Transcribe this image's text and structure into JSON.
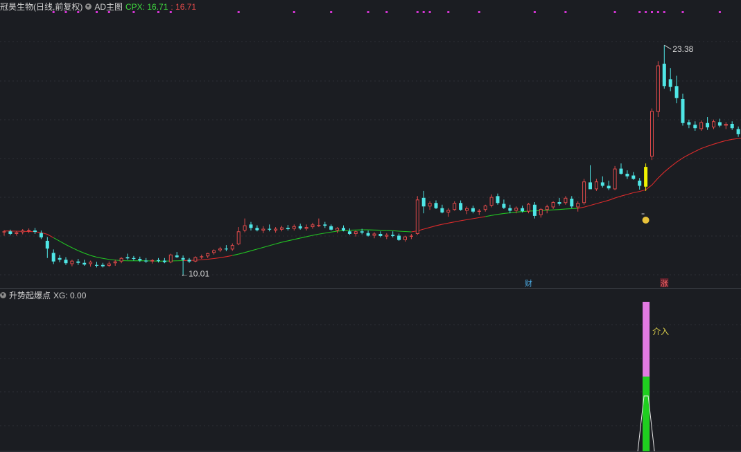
{
  "header": {
    "stock_title": "冠昊生物(日线,前复权)",
    "main_indicator": "AD主图",
    "cpx_label": "CPX: 16.71",
    "cpx_value2": ": 16.71",
    "sub_indicator": "升势起爆点",
    "xg_label": "XG: 0.00"
  },
  "annotations": {
    "high_label": "23.38",
    "low_label": "←10.01",
    "event_cai": "财",
    "event_zhang": "涨",
    "entry_label": "介入"
  },
  "colors": {
    "background": "#1b1d22",
    "up": "#e04a4a",
    "down": "#4fe6e6",
    "highlight_bar": "#f2f200",
    "ma_up": "#dd2b2b",
    "ma_down": "#22c422",
    "signal_pink": "#e27ae2",
    "signal_green": "#1fcf1f",
    "dot_magenta": "#d235d2",
    "label_yellow": "#d8cc4a"
  },
  "chart_data": [
    {
      "type": "candlestick",
      "title": "冠昊生物(日线,前复权)",
      "ylim": [
        9.3,
        25.2
      ],
      "high": 23.38,
      "low": 10.01,
      "last_close": 16.71,
      "series": [
        {
          "name": "candles",
          "columns": [
            "open",
            "high",
            "low",
            "close"
          ],
          "values": [
            [
              12.5,
              12.62,
              12.3,
              12.55
            ],
            [
              12.55,
              12.65,
              12.32,
              12.4
            ],
            [
              12.4,
              12.58,
              12.3,
              12.5
            ],
            [
              12.5,
              12.68,
              12.38,
              12.6
            ],
            [
              12.55,
              12.72,
              12.45,
              12.62
            ],
            [
              12.6,
              12.75,
              12.4,
              12.52
            ],
            [
              12.45,
              12.6,
              12.1,
              12.2
            ],
            [
              12.0,
              12.22,
              11.0,
              11.55
            ],
            [
              11.3,
              11.5,
              10.65,
              10.8
            ],
            [
              11.0,
              11.18,
              10.75,
              10.9
            ],
            [
              10.9,
              11.05,
              10.6,
              10.7
            ],
            [
              10.65,
              10.9,
              10.52,
              10.84
            ],
            [
              10.8,
              10.95,
              10.6,
              10.72
            ],
            [
              10.72,
              10.9,
              10.55,
              10.62
            ],
            [
              10.65,
              10.85,
              10.5,
              10.78
            ],
            [
              10.6,
              10.78,
              10.45,
              10.55
            ],
            [
              10.6,
              10.72,
              10.45,
              10.52
            ],
            [
              10.55,
              10.8,
              10.48,
              10.68
            ],
            [
              10.7,
              10.9,
              10.55,
              10.8
            ],
            [
              10.8,
              11.05,
              10.7,
              11.0
            ],
            [
              11.05,
              11.25,
              10.9,
              10.98
            ],
            [
              11.0,
              11.12,
              10.85,
              10.95
            ],
            [
              10.95,
              11.08,
              10.78,
              10.86
            ],
            [
              10.85,
              11.0,
              10.72,
              10.8
            ],
            [
              10.8,
              10.94,
              10.68,
              10.88
            ],
            [
              10.88,
              11.0,
              10.74,
              10.82
            ],
            [
              10.85,
              11.0,
              10.7,
              10.76
            ],
            [
              10.75,
              11.25,
              10.7,
              11.2
            ],
            [
              11.15,
              11.35,
              11.0,
              11.05
            ],
            [
              11.0,
              11.15,
              10.01,
              10.9
            ],
            [
              10.9,
              11.0,
              10.72,
              10.8
            ],
            [
              10.8,
              11.1,
              10.75,
              11.05
            ],
            [
              11.05,
              11.2,
              10.95,
              11.1
            ],
            [
              11.1,
              11.3,
              11.0,
              11.28
            ],
            [
              11.3,
              11.5,
              11.2,
              11.45
            ],
            [
              11.45,
              11.65,
              11.35,
              11.55
            ],
            [
              11.55,
              11.75,
              11.4,
              11.5
            ],
            [
              11.5,
              11.85,
              11.42,
              11.75
            ],
            [
              11.8,
              12.8,
              11.75,
              12.55
            ],
            [
              12.6,
              13.3,
              12.5,
              12.9
            ],
            [
              12.95,
              13.1,
              12.6,
              12.75
            ],
            [
              12.75,
              12.9,
              12.55,
              12.62
            ],
            [
              12.6,
              12.85,
              12.45,
              12.7
            ],
            [
              12.7,
              12.95,
              12.55,
              12.65
            ],
            [
              12.6,
              12.8,
              12.48,
              12.7
            ],
            [
              12.65,
              12.88,
              12.55,
              12.78
            ],
            [
              12.75,
              12.92,
              12.6,
              12.68
            ],
            [
              12.7,
              12.95,
              12.6,
              12.85
            ],
            [
              12.85,
              13.0,
              12.65,
              12.72
            ],
            [
              12.7,
              12.95,
              12.6,
              12.8
            ],
            [
              12.8,
              13.05,
              12.7,
              12.95
            ],
            [
              12.9,
              13.3,
              12.8,
              12.92
            ],
            [
              12.95,
              13.1,
              12.75,
              12.88
            ],
            [
              12.85,
              12.95,
              12.6,
              12.65
            ],
            [
              12.6,
              12.8,
              12.45,
              12.75
            ],
            [
              12.75,
              12.9,
              12.55,
              12.6
            ],
            [
              12.55,
              12.72,
              12.35,
              12.4
            ],
            [
              12.4,
              12.6,
              12.25,
              12.55
            ],
            [
              12.55,
              12.7,
              12.38,
              12.48
            ],
            [
              12.45,
              12.6,
              12.25,
              12.3
            ],
            [
              12.3,
              12.5,
              12.15,
              12.42
            ],
            [
              12.4,
              12.55,
              12.2,
              12.28
            ],
            [
              12.25,
              12.45,
              12.1,
              12.35
            ],
            [
              12.35,
              12.55,
              12.2,
              12.28
            ],
            [
              12.3,
              12.42,
              12.0,
              12.05
            ],
            [
              12.05,
              12.3,
              11.95,
              12.25
            ],
            [
              12.25,
              12.4,
              12.1,
              12.3
            ],
            [
              12.4,
              14.6,
              12.35,
              14.4
            ],
            [
              14.5,
              14.9,
              13.6,
              14.0
            ],
            [
              14.0,
              14.3,
              13.8,
              14.2
            ],
            [
              14.2,
              14.35,
              13.85,
              13.9
            ],
            [
              13.9,
              14.1,
              13.6,
              13.65
            ],
            [
              13.65,
              13.9,
              13.4,
              13.8
            ],
            [
              13.8,
              14.3,
              13.75,
              14.2
            ],
            [
              14.2,
              14.35,
              13.75,
              13.8
            ],
            [
              13.75,
              14.0,
              13.55,
              13.9
            ],
            [
              13.9,
              14.05,
              13.6,
              13.7
            ],
            [
              13.7,
              13.85,
              13.5,
              13.75
            ],
            [
              13.8,
              14.1,
              13.7,
              14.05
            ],
            [
              14.05,
              14.7,
              13.95,
              14.55
            ],
            [
              14.6,
              14.75,
              14.1,
              14.2
            ],
            [
              14.15,
              14.4,
              13.85,
              13.92
            ],
            [
              13.9,
              14.1,
              13.6,
              13.75
            ],
            [
              13.75,
              14.0,
              13.6,
              13.92
            ],
            [
              13.9,
              14.05,
              13.65,
              13.72
            ],
            [
              13.7,
              14.2,
              13.6,
              14.15
            ],
            [
              14.1,
              14.25,
              13.3,
              13.45
            ],
            [
              13.5,
              13.9,
              13.35,
              13.85
            ],
            [
              13.8,
              14.1,
              13.6,
              14.0
            ],
            [
              13.95,
              14.3,
              13.85,
              14.25
            ],
            [
              14.25,
              14.5,
              14.05,
              14.15
            ],
            [
              14.2,
              14.6,
              14.1,
              14.5
            ],
            [
              14.45,
              14.6,
              13.9,
              14.0
            ],
            [
              13.95,
              14.3,
              13.7,
              14.2
            ],
            [
              14.2,
              15.6,
              14.1,
              15.45
            ],
            [
              15.4,
              16.4,
              15.2,
              15.0
            ],
            [
              15.0,
              15.6,
              14.9,
              15.45
            ],
            [
              15.4,
              15.75,
              15.1,
              15.2
            ],
            [
              15.2,
              15.5,
              14.95,
              15.05
            ],
            [
              15.0,
              16.35,
              14.95,
              16.2
            ],
            [
              16.2,
              16.5,
              15.85,
              15.9
            ],
            [
              15.9,
              16.1,
              15.6,
              15.75
            ],
            [
              15.8,
              16.0,
              15.55,
              15.6
            ],
            [
              15.5,
              15.65,
              14.98,
              15.2
            ],
            [
              15.15,
              16.5,
              14.9,
              16.3
            ],
            [
              16.9,
              19.7,
              16.7,
              19.55
            ],
            [
              19.5,
              22.45,
              19.2,
              22.2
            ],
            [
              22.3,
              23.38,
              20.85,
              21.0
            ],
            [
              21.4,
              22.05,
              20.7,
              20.95
            ],
            [
              21.0,
              21.6,
              20.0,
              20.3
            ],
            [
              20.25,
              20.55,
              18.7,
              18.85
            ],
            [
              18.9,
              19.05,
              18.55,
              18.75
            ],
            [
              18.75,
              18.95,
              18.4,
              18.55
            ],
            [
              18.5,
              19.0,
              18.4,
              18.9
            ],
            [
              18.85,
              19.2,
              18.45,
              18.6
            ],
            [
              18.6,
              19.05,
              18.5,
              18.95
            ],
            [
              18.9,
              19.1,
              18.6,
              18.7
            ],
            [
              18.7,
              18.9,
              18.5,
              18.8
            ],
            [
              18.8,
              18.95,
              18.45,
              18.55
            ],
            [
              18.5,
              18.65,
              18.05,
              18.2
            ],
            [
              18.2,
              18.5,
              18.05,
              18.4
            ]
          ]
        },
        {
          "name": "ma",
          "values": [
            12.58,
            12.57,
            12.56,
            12.55,
            12.54,
            12.53,
            12.48,
            12.38,
            12.18,
            11.98,
            11.78,
            11.6,
            11.43,
            11.28,
            11.15,
            11.05,
            10.98,
            10.92,
            10.88,
            10.85,
            10.84,
            10.84,
            10.84,
            10.84,
            10.83,
            10.82,
            10.82,
            10.83,
            10.84,
            10.85,
            10.86,
            10.87,
            10.9,
            10.93,
            10.97,
            11.02,
            11.08,
            11.15,
            11.23,
            11.32,
            11.42,
            11.52,
            11.62,
            11.72,
            11.82,
            11.92,
            12.0,
            12.08,
            12.16,
            12.24,
            12.32,
            12.39,
            12.45,
            12.51,
            12.56,
            12.6,
            12.62,
            12.63,
            12.64,
            12.64,
            12.63,
            12.62,
            12.61,
            12.59,
            12.56,
            12.54,
            12.52,
            12.58,
            12.68,
            12.78,
            12.88,
            12.96,
            13.03,
            13.1,
            13.17,
            13.23,
            13.29,
            13.35,
            13.41,
            13.48,
            13.54,
            13.59,
            13.63,
            13.67,
            13.7,
            13.73,
            13.74,
            13.76,
            13.78,
            13.8,
            13.82,
            13.85,
            13.87,
            13.89,
            13.96,
            14.06,
            14.16,
            14.26,
            14.36,
            14.49,
            14.6,
            14.7,
            14.8,
            14.87,
            14.97,
            15.25,
            15.65,
            16.0,
            16.3,
            16.58,
            16.82,
            17.02,
            17.2,
            17.37,
            17.5,
            17.62,
            17.73,
            17.83,
            17.9,
            17.95,
            18.0
          ]
        }
      ],
      "ma_colored_green_ranges": [
        [
          8,
          29
        ],
        [
          37,
          66
        ],
        [
          78,
          93
        ]
      ],
      "highlight_index": 104,
      "low_index": 29,
      "high_index": 107,
      "event_markers": [
        {
          "index": 85,
          "label": "财"
        },
        {
          "index": 107,
          "label": "涨"
        }
      ],
      "signal_dots_indices": [
        8,
        10,
        12,
        15,
        17,
        21,
        25,
        27,
        38,
        47,
        53,
        59,
        62,
        67,
        72,
        77,
        86,
        91,
        99,
        107,
        110,
        116,
        121
      ],
      "signal_dots_cluster": [
        [
          103,
          104,
          105,
          106,
          107
        ],
        [
          67,
          68,
          69
        ]
      ]
    },
    {
      "type": "bar",
      "title": "升势起爆点",
      "ylim": [
        0,
        1
      ],
      "series": [
        {
          "name": "XG",
          "signal_index": 104,
          "value": 0.0,
          "pink_fraction": 1.0,
          "green_fraction": 0.5
        }
      ],
      "annotations": [
        "介入"
      ]
    }
  ]
}
